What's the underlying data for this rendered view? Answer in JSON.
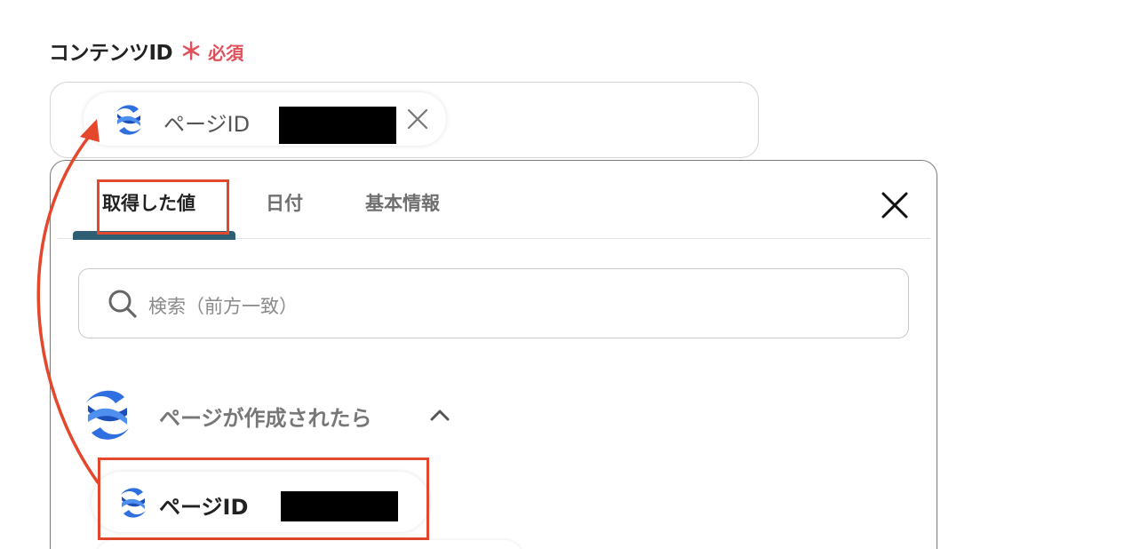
{
  "field": {
    "label": "コンテンツID",
    "asterisk": "＊",
    "required": "必須"
  },
  "selected_chip": {
    "icon": "confluence-logo-icon",
    "label": "ページID"
  },
  "panel": {
    "tabs": [
      {
        "label": "取得した値",
        "active": true
      },
      {
        "label": "日付",
        "active": false
      },
      {
        "label": "基本情報",
        "active": false
      }
    ],
    "search": {
      "placeholder": "検索（前方一致）"
    },
    "section": {
      "title": "ページが作成されたら",
      "expanded": true
    },
    "items": [
      {
        "label": "ページID",
        "icon": "confluence-logo-icon"
      }
    ]
  },
  "colors": {
    "accent_red": "#e4472b",
    "required_red": "#e0505a",
    "tab_underline": "#2f5f74",
    "confluence_blue": "#2f6fe0"
  }
}
